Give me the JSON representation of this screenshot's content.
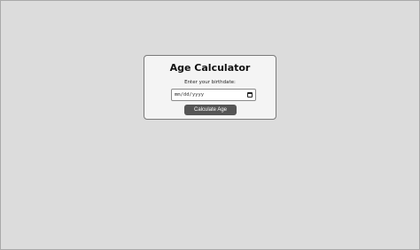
{
  "app": {
    "title": "Age Calculator",
    "prompt_label": "Enter your birthdate:",
    "birthdate_input": {
      "value": "",
      "placeholder_display": "mm/dd/yyyy"
    },
    "calculate_button_label": "Calculate Age"
  },
  "colors": {
    "page_background": "#dcdcdc",
    "card_background": "#f4f4f4",
    "button_background": "#555555",
    "button_text": "#ffffff"
  },
  "icons": {
    "date_picker": "calendar-icon"
  }
}
